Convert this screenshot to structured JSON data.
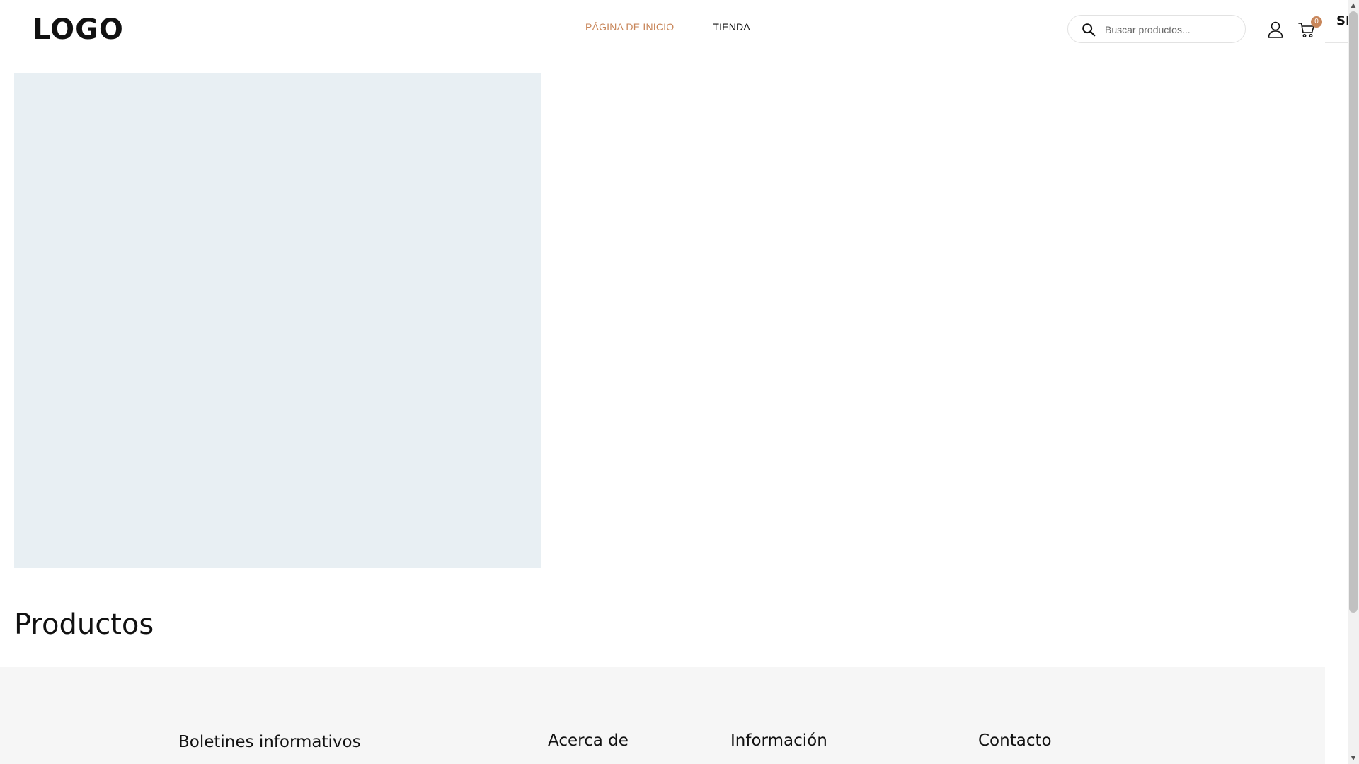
{
  "header": {
    "logo": "LOGO",
    "nav": [
      {
        "label": "PÁGINA DE INICIO",
        "active": true
      },
      {
        "label": "TIENDA",
        "active": false
      }
    ],
    "search": {
      "placeholder": "Buscar productos...",
      "value": ""
    },
    "cart": {
      "count": "0"
    },
    "icons": {
      "search": "search-icon",
      "user": "user-icon",
      "cart": "cart-icon"
    }
  },
  "side_panel": {
    "text": "SH"
  },
  "main": {
    "products_title": "Productos"
  },
  "footer": {
    "headings": [
      "Boletines informativos",
      "Acerca de",
      "Información",
      "Contacto"
    ]
  },
  "colors": {
    "accent": "#c8865a",
    "hero_placeholder": "#e8eff3",
    "footer_bg": "#f6f6f6"
  },
  "scrollbar": {
    "up_icon": "▲",
    "down_icon": "▼"
  }
}
